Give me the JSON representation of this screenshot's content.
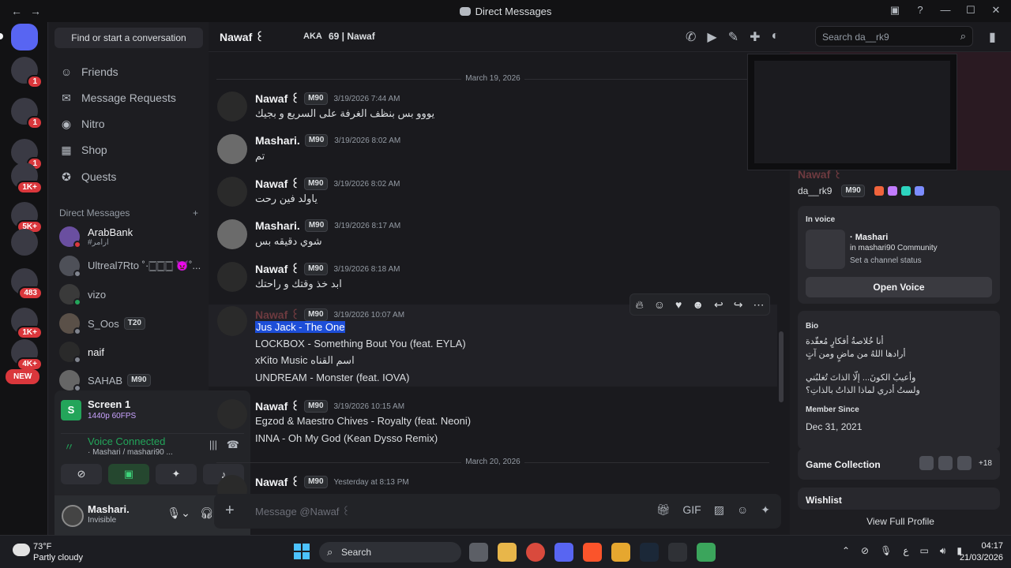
{
  "window": {
    "title": "Direct Messages"
  },
  "sidebar": {
    "search_label": "Find or start a conversation",
    "nav": [
      {
        "label": "Friends",
        "icon": "person-wave-icon"
      },
      {
        "label": "Message Requests",
        "icon": "envelope-icon"
      },
      {
        "label": "Nitro",
        "icon": "nitro-icon"
      },
      {
        "label": "Shop",
        "icon": "shop-icon"
      },
      {
        "label": "Quests",
        "icon": "quests-icon"
      }
    ],
    "dm_header": "Direct Messages",
    "dms": [
      {
        "name": "ArabBank",
        "sub": "#ارامر"
      },
      {
        "name": "Ultreal7Rto ˚·🀆🀆🀆 👿˚..."
      },
      {
        "name": "vizo"
      },
      {
        "name": "S_Oos",
        "tag": "T20"
      },
      {
        "name": "naif"
      },
      {
        "name": "SAHAB",
        "tag": "M90"
      }
    ]
  },
  "guild_badges": [
    "1",
    "1",
    "1",
    "1K+",
    "5K+",
    "483",
    "1K+",
    "4K+"
  ],
  "new_pill": "NEW",
  "voice": {
    "screen_title": "Screen 1",
    "screen_sub": "1440p 60FPS",
    "connected": "Voice Connected",
    "channel": "· Mashari / mashari90 ..."
  },
  "user": {
    "name": "Mashari.",
    "status": "Invisible"
  },
  "header": {
    "name": "Nawaf ꒰",
    "aka": "AKA",
    "guild_info": "69 | Nawaf",
    "search_placeholder": "Search da__rk9"
  },
  "dates": [
    "March 19, 2026",
    "March 20, 2026"
  ],
  "messages": [
    {
      "author": "Nawaf ꒰",
      "tag": "M90",
      "time": "3/19/2026 7:44 AM",
      "lines": [
        "يووو بس بنظف الغرفة على السريع و بجيك"
      ]
    },
    {
      "author": "Mashari.",
      "tag": "M90",
      "time": "3/19/2026 8:02 AM",
      "lines": [
        "تم"
      ]
    },
    {
      "author": "Nawaf ꒰",
      "tag": "M90",
      "time": "3/19/2026 8:02 AM",
      "lines": [
        "ياولد فين رحت"
      ]
    },
    {
      "author": "Mashari.",
      "tag": "M90",
      "time": "3/19/2026 8:17 AM",
      "lines": [
        "شوي دقيقه بس"
      ]
    },
    {
      "author": "Nawaf ꒰",
      "tag": "M90",
      "time": "3/19/2026 8:18 AM",
      "lines": [
        "ابد خذ وقتك و راحتك"
      ]
    },
    {
      "author": "Nawaf ꒰",
      "tag": "M90",
      "time": "3/19/2026 10:07 AM",
      "lines": [
        "Jus Jack - The One",
        "LOCKBOX - Something Bout You (feat. EYLA)",
        "xKito Music اسم القناه",
        "UNDREAM - Monster (feat. IOVA)"
      ]
    },
    {
      "author": "Nawaf ꒰",
      "tag": "M90",
      "time": "3/19/2026 10:15 AM",
      "lines": [
        "Egzod & Maestro Chives - Royalty (feat. Neoni)",
        "INNA - Oh My God (Kean Dysso Remix)"
      ]
    },
    {
      "author": "Nawaf ꒰",
      "tag": "M90",
      "time": "Yesterday at 8:13 PM",
      "lines": []
    }
  ],
  "composer": {
    "placeholder": "Message @Nawaf ꒰"
  },
  "profile": {
    "display_name": "Nawaf ꒰",
    "username": "da__rk9",
    "tag": "M90",
    "in_voice_label": "In voice",
    "voice_title": "· Mashari",
    "voice_server": "in mashari90 Community",
    "voice_status": "Set a channel status",
    "open_voice": "Open Voice",
    "bio_label": "Bio",
    "bio_lines": [
      "أنا خُلاصةُ أفكارٍ مُعقّدة",
      "أرادها اللهُ من ماضٍ ومن آتٍ",
      "",
      "وأعيبُ الكونَ... إلّا الذاتَ تُغلبُني",
      "ولستُ أدري لماذا الذاتُ بالذاتِ؟"
    ],
    "since_label": "Member Since",
    "since_value": "Dec 31, 2021",
    "game_collection": "Game Collection",
    "game_count": "+18",
    "wishlist": "Wishlist",
    "view_full": "View Full Profile"
  },
  "taskbar": {
    "temp": "73°F",
    "condition": "Partly cloudy",
    "search": "Search",
    "time": "04:17",
    "date": "21/03/2026",
    "lang": "ع"
  }
}
